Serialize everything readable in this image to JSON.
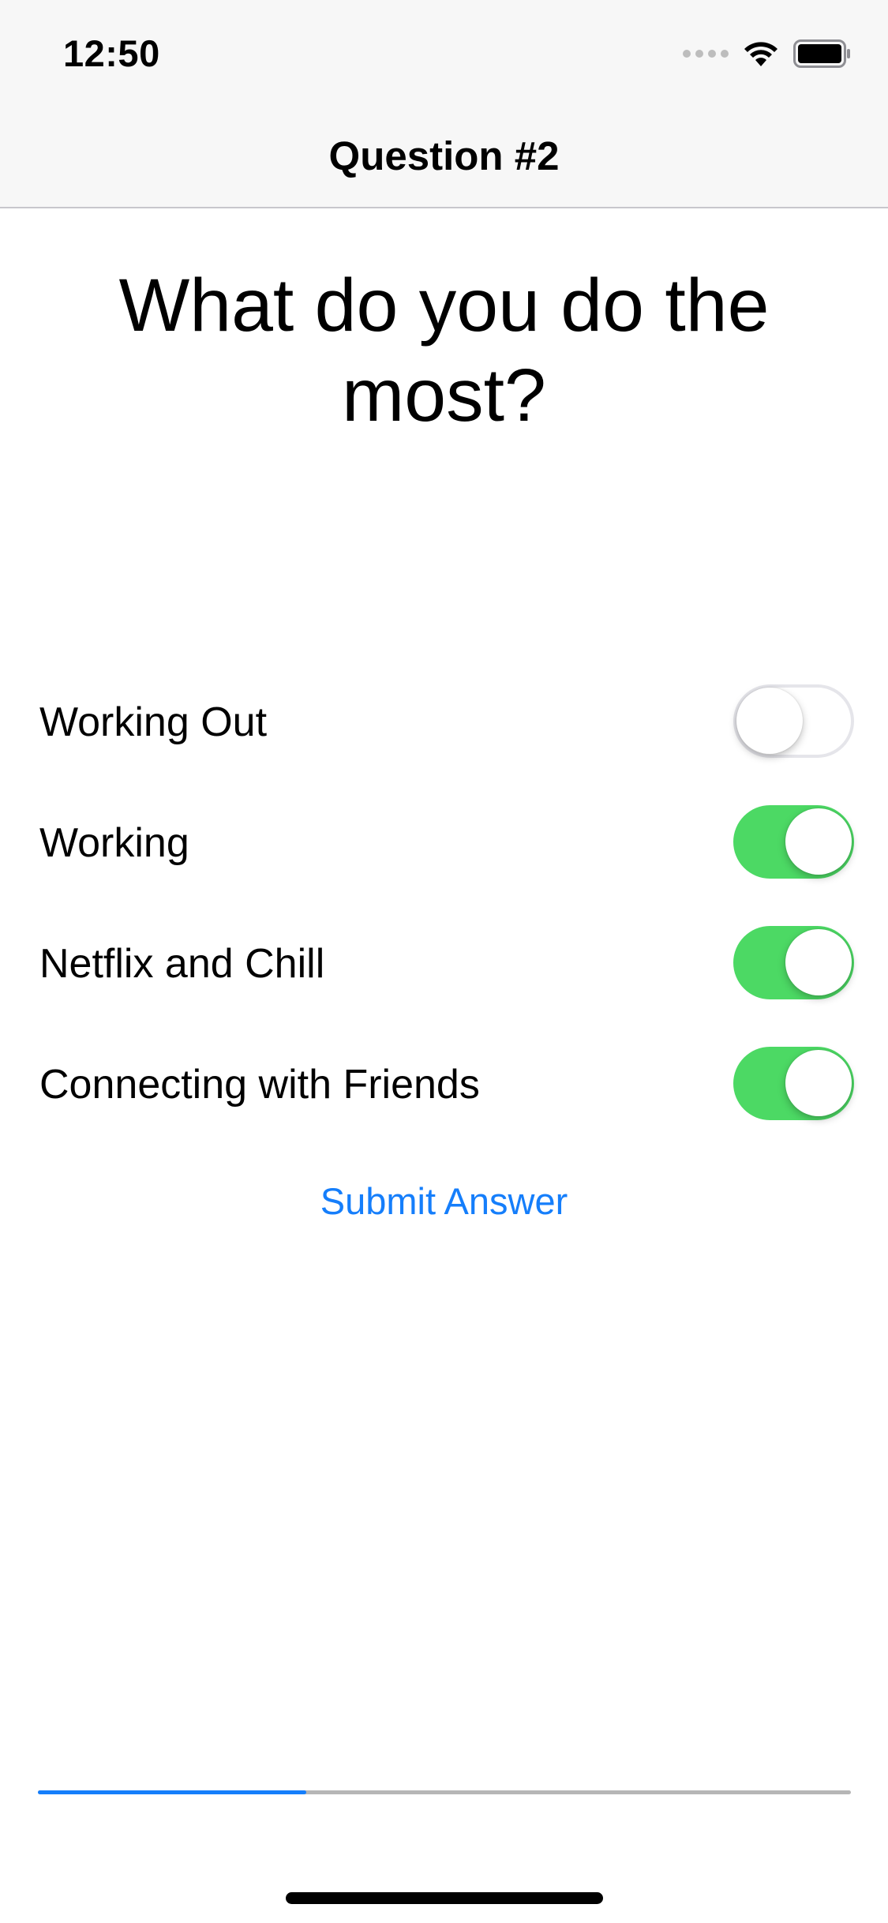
{
  "status_bar": {
    "time": "12:50",
    "icons": [
      "signal-dots-icon",
      "wifi-icon",
      "battery-icon"
    ]
  },
  "nav": {
    "title": "Question #2"
  },
  "question": {
    "text": "What do you do the most?"
  },
  "options": [
    {
      "label": "Working Out",
      "on": false
    },
    {
      "label": "Working",
      "on": true
    },
    {
      "label": "Netflix and Chill",
      "on": true
    },
    {
      "label": "Connecting with Friends",
      "on": true
    }
  ],
  "submit": {
    "label": "Submit Answer"
  },
  "progress": {
    "fraction": 0.33
  },
  "colors": {
    "accent": "#157efb",
    "toggle_on": "#4cd964",
    "toggle_off_border": "#e5e5ea",
    "bar_background": "#f7f7f7",
    "progress_track": "#b6b6b6"
  }
}
